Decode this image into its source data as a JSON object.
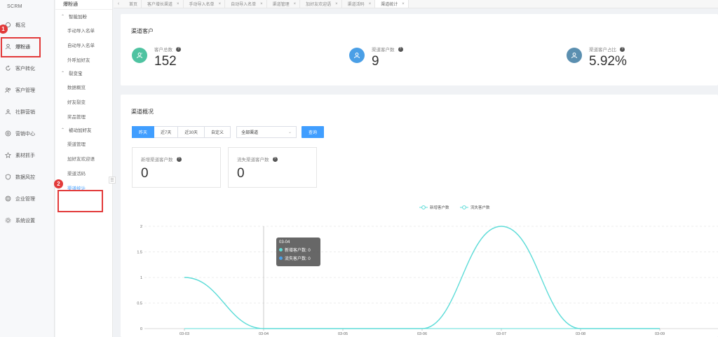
{
  "brand": "SCRM",
  "nav": [
    {
      "label": "概况",
      "icon": "circle-icon"
    },
    {
      "label": "爆粉通",
      "icon": "user-icon",
      "active": true
    },
    {
      "label": "客户转化",
      "icon": "refresh-icon"
    },
    {
      "label": "客户管理",
      "icon": "users-icon"
    },
    {
      "label": "社群营销",
      "icon": "group-icon"
    },
    {
      "label": "营销中心",
      "icon": "target-icon"
    },
    {
      "label": "素材抓手",
      "icon": "star-icon"
    },
    {
      "label": "数据风控",
      "icon": "shield-icon"
    },
    {
      "label": "企业管理",
      "icon": "building-icon"
    },
    {
      "label": "系统设置",
      "icon": "gear-icon"
    }
  ],
  "subnav": {
    "title": "爆粉通",
    "groups": [
      {
        "label": "智能加粉",
        "items": [
          "手动导入名单",
          "自动导入名单",
          "外呼加好友"
        ]
      },
      {
        "label": "裂变宝",
        "items": [
          "数据概览",
          "好友裂变",
          "奖品管理"
        ]
      },
      {
        "label": "被动加好友",
        "items": [
          "渠道管理",
          "加好友欢迎语",
          "渠道活码",
          "渠道统计"
        ]
      }
    ],
    "active_item": "渠道统计"
  },
  "tabs": [
    "首页",
    "客户增长渠道",
    "手动导入名单",
    "自动导入名单",
    "渠道管理",
    "加好友欢迎语",
    "渠道活码",
    "渠道统计"
  ],
  "summary": {
    "title": "渠道客户",
    "stats": [
      {
        "label": "客户总数",
        "value": "152",
        "color": "#4fc3a1"
      },
      {
        "label": "渠道客户数",
        "value": "9",
        "color": "#4a9fe6"
      },
      {
        "label": "渠道客户占比",
        "value": "5.92%",
        "color": "#5b8fb0"
      }
    ]
  },
  "overview": {
    "title": "渠道概况",
    "date_buttons": [
      "昨天",
      "近7天",
      "近30天",
      "自定义"
    ],
    "active_date_button": "昨天",
    "channel_select": "全部渠道",
    "query_label": "查询",
    "mini_stats": [
      {
        "label": "新增渠道客户数",
        "value": "0"
      },
      {
        "label": "流失渠道客户数",
        "value": "0"
      }
    ]
  },
  "chart_data": {
    "type": "line",
    "categories": [
      "03-03",
      "03-04",
      "03-05",
      "03-06",
      "03-07",
      "03-08",
      "03-09"
    ],
    "series": [
      {
        "name": "新增客户数",
        "values": [
          1,
          0,
          0,
          0,
          2,
          0,
          0
        ],
        "color": "#5ddcd8"
      },
      {
        "name": "流失客户数",
        "values": [
          0,
          0,
          0,
          0,
          0,
          0,
          0
        ],
        "color": "#5ddcd8"
      }
    ],
    "yticks": [
      "0",
      "0.5",
      "1",
      "1.5",
      "2"
    ],
    "ylim": [
      0,
      2
    ],
    "legend_position": "top-center",
    "grid": true,
    "tooltip": {
      "title": "03-04",
      "rows": [
        {
          "label": "新增客户数: 0",
          "color": "#5ddcd8"
        },
        {
          "label": "流失客户数: 0",
          "color": "#4a9fe6"
        }
      ]
    }
  },
  "annotations": {
    "marker1": "1",
    "marker2": "2"
  }
}
